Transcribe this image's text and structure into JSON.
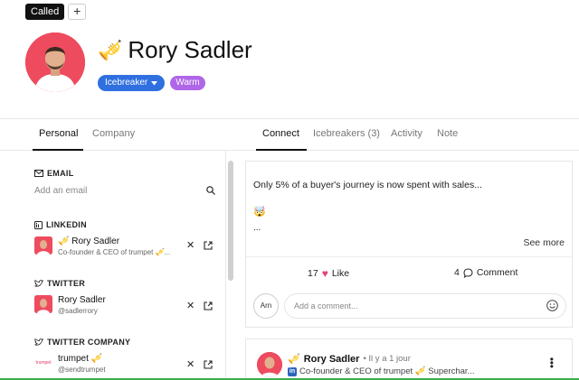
{
  "header": {
    "tag_called": "Called",
    "tag_add": "+",
    "name": "Rory Sadler",
    "trumpet_emoji": "🎺",
    "badge_icebreaker": "Icebreaker",
    "badge_warm": "Warm"
  },
  "colors": {
    "icebreaker": "#2f6fe0",
    "warm": "#b066e8",
    "avatar_bg": "#ee4b5f",
    "heart": "#e0457b",
    "progress": "#3fae49"
  },
  "left_tabs": [
    {
      "label": "Personal",
      "active": true
    },
    {
      "label": "Company",
      "active": false
    }
  ],
  "right_tabs": [
    {
      "label": "Connect",
      "active": true
    },
    {
      "label": "Icebreakers (3)",
      "active": false
    },
    {
      "label": "Activity",
      "active": false
    },
    {
      "label": "Note",
      "active": false
    }
  ],
  "sections": {
    "email": {
      "title": "EMAIL",
      "placeholder": "Add an email"
    },
    "linkedin": {
      "title": "LINKEDIN",
      "name": "🎺 Rory Sadler",
      "sub": "Co-founder & CEO of trumpet 🎺..."
    },
    "twitter": {
      "title": "TWITTER",
      "name": "Rory Sadler",
      "sub": "@sadlerrory"
    },
    "twitter_company": {
      "title": "TWITTER COMPANY",
      "logo_text": "trumpet",
      "name": "trumpet 🎺",
      "sub": "@sendtrumpet"
    }
  },
  "post": {
    "text": "Only 5% of a buyer's journey is now spent with sales...",
    "emoji": "🤯",
    "ellipsis": "...",
    "see_more": "See more",
    "likes_count": "17",
    "likes_label": "Like",
    "comments_count": "4",
    "comments_label": "Comment",
    "commenter_initials": "Arn",
    "comment_placeholder": "Add a comment..."
  },
  "post2": {
    "emoji": "🎺",
    "name": "Rory Sadler",
    "meta": "• Il y a 1 jour",
    "sub": "Co-founder & CEO of trumpet 🎺 Superchar..."
  }
}
